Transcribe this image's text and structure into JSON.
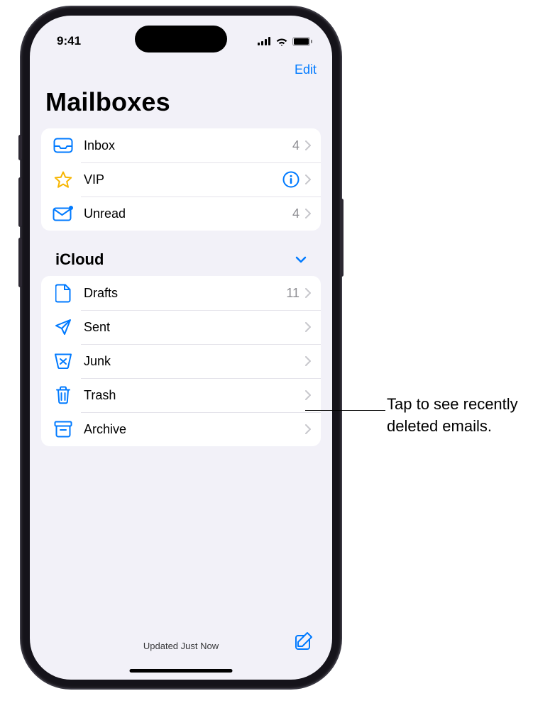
{
  "status": {
    "time": "9:41"
  },
  "nav": {
    "edit": "Edit"
  },
  "page": {
    "title": "Mailboxes"
  },
  "smart_mailboxes": [
    {
      "icon": "inbox-icon",
      "label": "Inbox",
      "count": "4",
      "info": false
    },
    {
      "icon": "star-icon",
      "label": "VIP",
      "count": "",
      "info": true
    },
    {
      "icon": "unread-icon",
      "label": "Unread",
      "count": "4",
      "info": false
    }
  ],
  "account": {
    "name": "iCloud",
    "folders": [
      {
        "icon": "drafts-icon",
        "label": "Drafts",
        "count": "11"
      },
      {
        "icon": "sent-icon",
        "label": "Sent",
        "count": ""
      },
      {
        "icon": "junk-icon",
        "label": "Junk",
        "count": ""
      },
      {
        "icon": "trash-icon",
        "label": "Trash",
        "count": ""
      },
      {
        "icon": "archive-icon",
        "label": "Archive",
        "count": ""
      }
    ]
  },
  "bottom": {
    "status": "Updated Just Now"
  },
  "callout": {
    "text": "Tap to see recently deleted emails."
  }
}
